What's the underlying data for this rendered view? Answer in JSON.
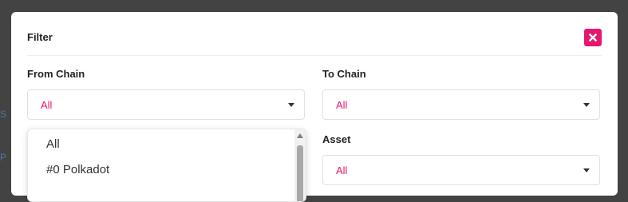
{
  "background": {
    "text1": "S",
    "text2": "P"
  },
  "modal": {
    "title": "Filter"
  },
  "from_chain": {
    "label": "From Chain",
    "value": "All"
  },
  "to_chain": {
    "label": "To Chain",
    "value": "All"
  },
  "asset": {
    "label": "Asset",
    "value": "All"
  },
  "dropdown": {
    "options": [
      "All",
      "#0 Polkadot"
    ]
  },
  "colors": {
    "accent": "#e6176f",
    "overlay": "#434343"
  }
}
